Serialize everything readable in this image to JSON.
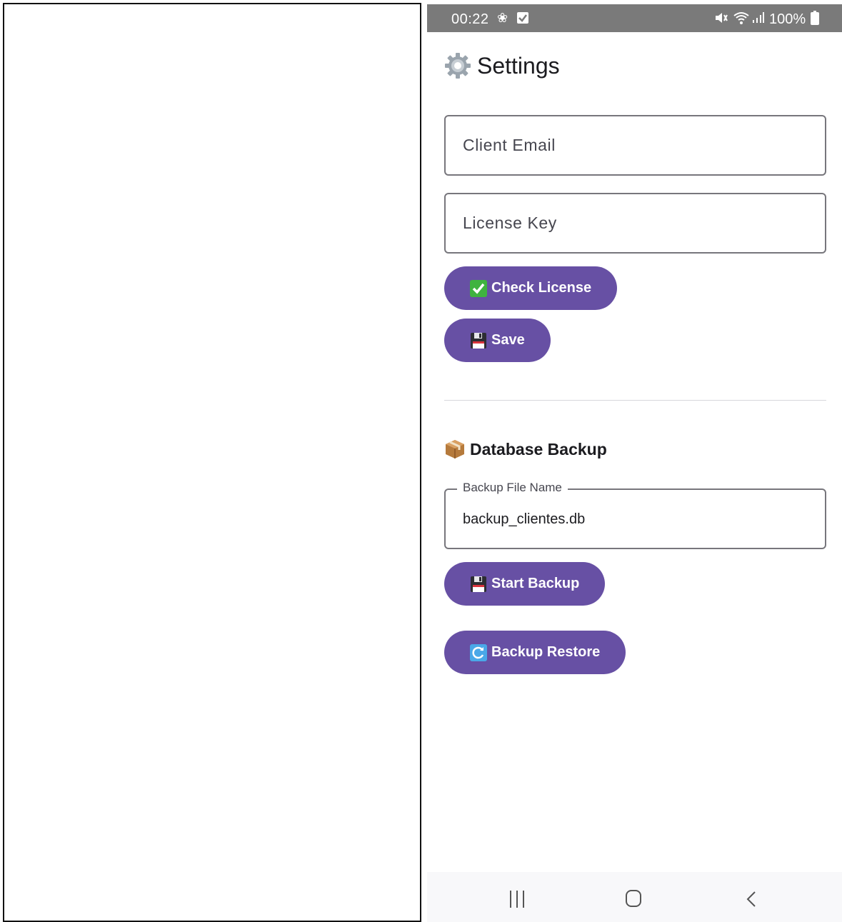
{
  "status_bar": {
    "time": "00:22",
    "battery": "100%"
  },
  "page": {
    "title": "Settings"
  },
  "form": {
    "client_email_placeholder": "Client Email",
    "license_key_placeholder": "License Key",
    "check_license_label": "Check License",
    "save_label": "Save"
  },
  "backup": {
    "section_title": "Database Backup",
    "file_name_label": "Backup File Name",
    "file_name_value": "backup_clientes.db",
    "start_backup_label": "Start Backup",
    "restore_label": "Backup Restore"
  },
  "colors": {
    "primary": "#6750a4",
    "status_bar": "#7a7a7a"
  }
}
